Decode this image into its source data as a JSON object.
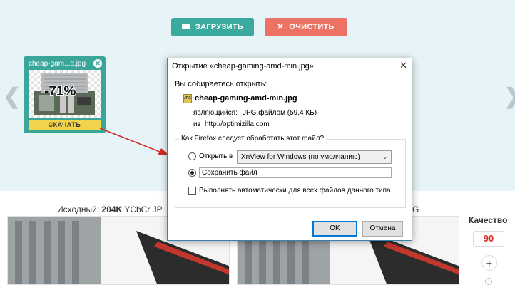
{
  "toolbar": {
    "upload_label": "ЗАГРУЗИТЬ",
    "clear_label": "ОЧИСТИТЬ"
  },
  "carousel": {
    "prev_glyph": "❮",
    "next_glyph": "❯"
  },
  "thumbnail": {
    "filename": "cheap-gam...d.jpg",
    "close_glyph": "✕",
    "percent": "-71%",
    "download_label": "СКАЧАТЬ"
  },
  "comparison": {
    "left_caption_prefix": "Исходный: ",
    "left_caption_bold": "204K",
    "left_caption_suffix": " YCbCr JP",
    "right_caption": "G"
  },
  "quality": {
    "label": "Качество",
    "value": "90",
    "plus": "+"
  },
  "dialog": {
    "title": "Открытие «cheap-gaming-amd-min.jpg»",
    "close_glyph": "✕",
    "intro": "Вы собираетесь открыть:",
    "file_icon_text": "JPG",
    "filename": "cheap-gaming-amd-min.jpg",
    "type_label": "являющийся:",
    "type_value": "JPG файлом (59,4 КБ)",
    "from_label": "из",
    "from_value": "http://optimizilla.com",
    "question": "Как Firefox следует обработать этот файл?",
    "open_with_label": "Открыть в",
    "open_with_app": "XnView for Windows (по умолчанию)",
    "select_caret": "⌄",
    "save_label": "Сохранить файл",
    "auto_label": "Выполнять автоматически для всех файлов данного типа.",
    "ok_label": "OK",
    "cancel_label": "Отмена",
    "selected_option": "save"
  },
  "colors": {
    "teal": "#3aaa9e",
    "coral": "#ee7263",
    "yellow": "#f1d44b",
    "arrow_red": "#d12b2b"
  }
}
